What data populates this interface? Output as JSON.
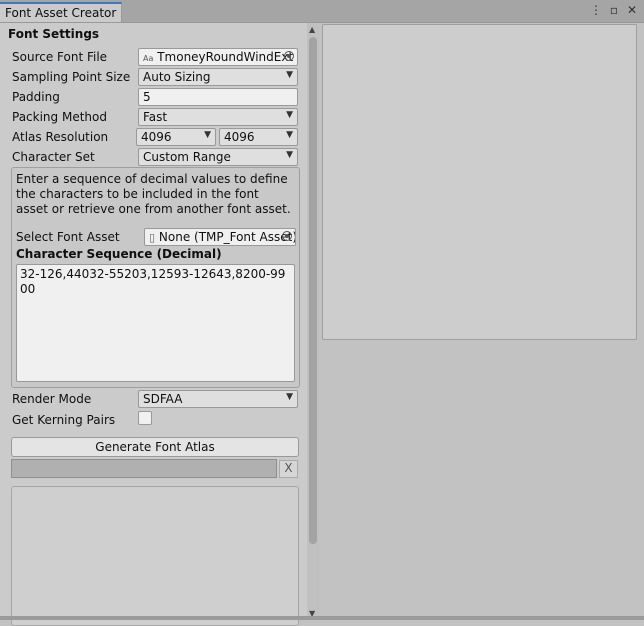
{
  "window": {
    "tab_title": "Font Asset Creator",
    "icons": [
      "more-options-icon",
      "maximize-icon",
      "close-icon"
    ]
  },
  "settings": {
    "section_title": "Font Settings",
    "source_font_file": {
      "label": "Source Font File",
      "value": "TmoneyRoundWindExt",
      "icon": "Aa"
    },
    "sampling_point_size": {
      "label": "Sampling Point Size",
      "value": "Auto Sizing"
    },
    "padding": {
      "label": "Padding",
      "value": "5"
    },
    "packing_method": {
      "label": "Packing Method",
      "value": "Fast"
    },
    "atlas_resolution": {
      "label": "Atlas Resolution",
      "width": "4096",
      "height": "4096"
    },
    "character_set": {
      "label": "Character Set",
      "value": "Custom Range"
    },
    "help_text": "Enter a sequence of decimal values to define the characters to be included in the font asset or retrieve one from another font asset.",
    "select_font_asset": {
      "label": "Select Font Asset",
      "value": "None (TMP_Font Asset)"
    },
    "character_sequence": {
      "label": "Character Sequence (Decimal)",
      "value": "32-126,44032-55203,12593-12643,8200-9900"
    },
    "render_mode": {
      "label": "Render Mode",
      "value": "SDFAA"
    },
    "get_kerning_pairs": {
      "label": "Get Kerning Pairs",
      "checked": false
    },
    "generate_button": "Generate Font Atlas",
    "cancel_label": "X"
  }
}
